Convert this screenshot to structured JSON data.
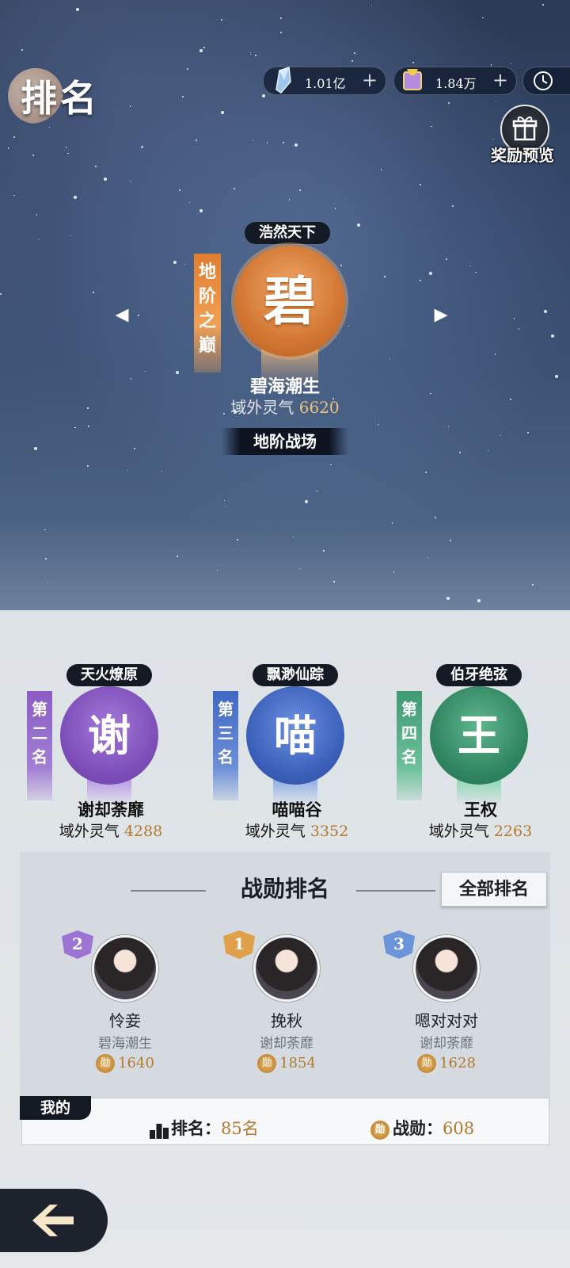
{
  "header": {
    "title": "排名"
  },
  "resources": [
    {
      "icon": "crystal-icon",
      "value": "1.01亿",
      "plus": "+"
    },
    {
      "icon": "scroll-icon",
      "value": "1.84万",
      "plus": "+"
    }
  ],
  "clock_icon": "clock-icon",
  "reward_preview": {
    "label": "奖励预览",
    "icon": "gift-icon"
  },
  "champion": {
    "tag": "浩然天下",
    "char": "碧",
    "banner": "地阶之巅",
    "name": "碧海潮生",
    "aura_label": "域外灵气",
    "aura_value": "6620",
    "battlefield": "地阶战场"
  },
  "arrows": {
    "left": "◂",
    "right": "▸"
  },
  "ranks": [
    {
      "tag": "天火燎原",
      "char": "谢",
      "banner": "第二名",
      "name": "谢却荼靡",
      "aura_label": "域外灵气",
      "aura_value": "4288",
      "color": "#7f52b8"
    },
    {
      "tag": "飘渺仙踪",
      "char": "喵",
      "banner": "第三名",
      "name": "喵喵谷",
      "aura_label": "域外灵气",
      "aura_value": "3352",
      "color": "#3d63b8"
    },
    {
      "tag": "伯牙绝弦",
      "char": "王",
      "banner": "第四名",
      "name": "王权",
      "aura_label": "域外灵气",
      "aura_value": "2263",
      "color": "#3a8a68"
    }
  ],
  "merit": {
    "title": "战勋排名",
    "all_button": "全部排名",
    "players": [
      {
        "rank": "2",
        "name": "怜妾",
        "guild": "碧海潮生",
        "points": "1640"
      },
      {
        "rank": "1",
        "name": "挽秋",
        "guild": "谢却荼靡",
        "points": "1854"
      },
      {
        "rank": "3",
        "name": "嗯对对对",
        "guild": "谢却荼靡",
        "points": "1628"
      }
    ],
    "coin_glyph": "勋"
  },
  "mine": {
    "tag": "我的",
    "rank_label": "排名：",
    "rank_value": "85名",
    "merit_label": "战勋：",
    "merit_value": "608"
  },
  "back_icon": "back-arrow-icon"
}
